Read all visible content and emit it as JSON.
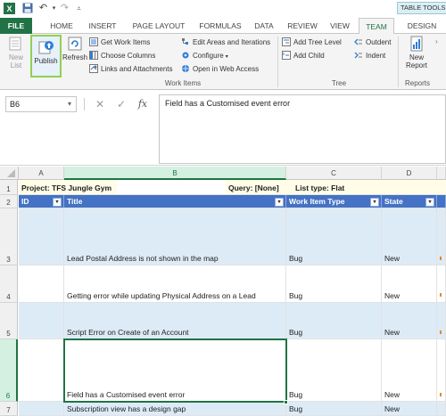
{
  "quick_access": {
    "excel_icon": "excel-icon",
    "save_icon": "save-icon",
    "undo_icon": "undo-icon",
    "redo_icon": "redo-icon",
    "customize_icon": "customize-qat-icon"
  },
  "context_tab_label": "TABLE TOOLS",
  "tabs": [
    "FILE",
    "HOME",
    "INSERT",
    "PAGE LAYOUT",
    "FORMULAS",
    "DATA",
    "REVIEW",
    "VIEW",
    "TEAM",
    "DESIGN"
  ],
  "ribbon": {
    "new_list": "New List",
    "new_list_line1": "New",
    "new_list_line2": "List",
    "publish": "Publish",
    "refresh": "Refresh",
    "get_work_items": "Get Work Items",
    "choose_columns": "Choose Columns",
    "links_attachments": "Links and Attachments",
    "edit_areas": "Edit Areas and Iterations",
    "configure": "Configure",
    "open_web": "Open in Web Access",
    "group_work_items": "Work Items",
    "add_tree_level": "Add Tree Level",
    "add_child": "Add Child",
    "outdent": "Outdent",
    "indent": "Indent",
    "group_tree": "Tree",
    "new_report_line1": "New",
    "new_report_line2": "Report",
    "group_reports": "Reports"
  },
  "formula_bar": {
    "name_box": "B6",
    "cancel_symbol": "✕",
    "enter_symbol": "✓",
    "fx_symbol": "fx",
    "formula": "Field has a Customised event error"
  },
  "columns": [
    "A",
    "B",
    "C",
    "D"
  ],
  "rows": {
    "project": {
      "num": "1",
      "project_label": "Project: TFS Jungle Gym",
      "query_label": "Query: [None]",
      "list_type_label": "List type: Flat"
    },
    "header": {
      "num": "2",
      "id": "ID",
      "title": "Title",
      "type": "Work Item Type",
      "state": "State"
    },
    "data": [
      {
        "num": "3",
        "id": "",
        "title": "Lead Postal Address is not shown in the map",
        "type": "Bug",
        "state": "New"
      },
      {
        "num": "4",
        "id": "",
        "title": "Getting error while updating Physical Address on a Lead",
        "type": "Bug",
        "state": "New"
      },
      {
        "num": "5",
        "id": "",
        "title": "Script Error on Create of an Account",
        "type": "Bug",
        "state": "New"
      },
      {
        "num": "6",
        "id": "",
        "title": "Field has a Customised event error",
        "type": "Bug",
        "state": "New"
      },
      {
        "num": "7",
        "id": "",
        "title": "Subscription view has a design gap",
        "type": "Bug",
        "state": "New"
      }
    ]
  },
  "colors": {
    "excel_green": "#217346",
    "table_header": "#4472c4",
    "band_blue": "#ddebf7",
    "publish_highlight": "#92d050"
  }
}
